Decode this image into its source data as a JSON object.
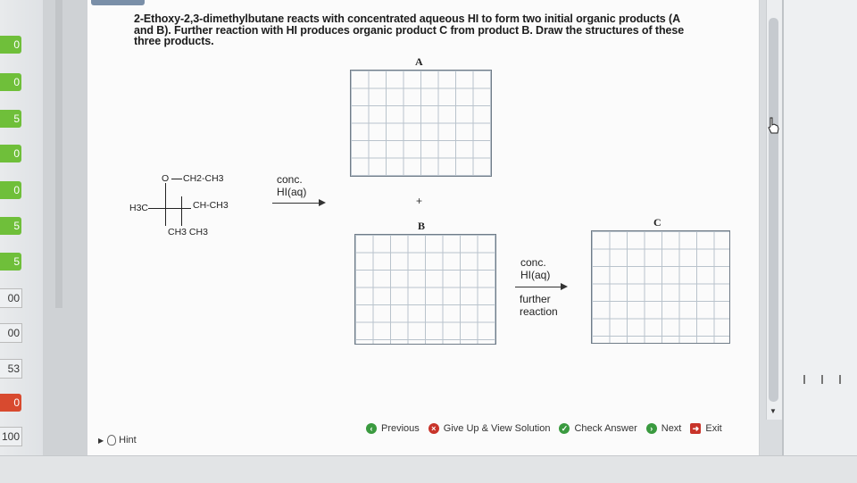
{
  "question": {
    "line1": "2-Ethoxy-2,3-dimethylbutane reacts with concentrated aqueous HI to form two initial organic products (A",
    "line2": "and B). Further reaction with HI produces organic product C from product B. Draw the structures of these",
    "line3": "three products."
  },
  "labels": {
    "a": "A",
    "b": "B",
    "c": "C"
  },
  "molecule": {
    "o_group": "O",
    "ethyl": "CH2-CH3",
    "methyl_left": "H3C",
    "ch_group": "CH-CH3",
    "bottom_methyls": "CH3 CH3"
  },
  "reaction1": {
    "line1": "conc.",
    "line2": "HI(aq)"
  },
  "plus": "+",
  "reaction2": {
    "line1": "conc.",
    "line2": "HI(aq)",
    "line3": "further",
    "line4": "reaction"
  },
  "toolbar": {
    "previous": "Previous",
    "give_up": "Give Up & View Solution",
    "check": "Check Answer",
    "next": "Next",
    "exit": "Exit"
  },
  "hint": "Hint",
  "scores": [
    "0",
    "0",
    "5",
    "0",
    "0",
    "5",
    "5",
    "00",
    "00",
    "53",
    "0",
    "100"
  ],
  "colors": {
    "green": "#6fbf3a",
    "red": "#d84a2f",
    "grid": "#b9c3cc"
  }
}
